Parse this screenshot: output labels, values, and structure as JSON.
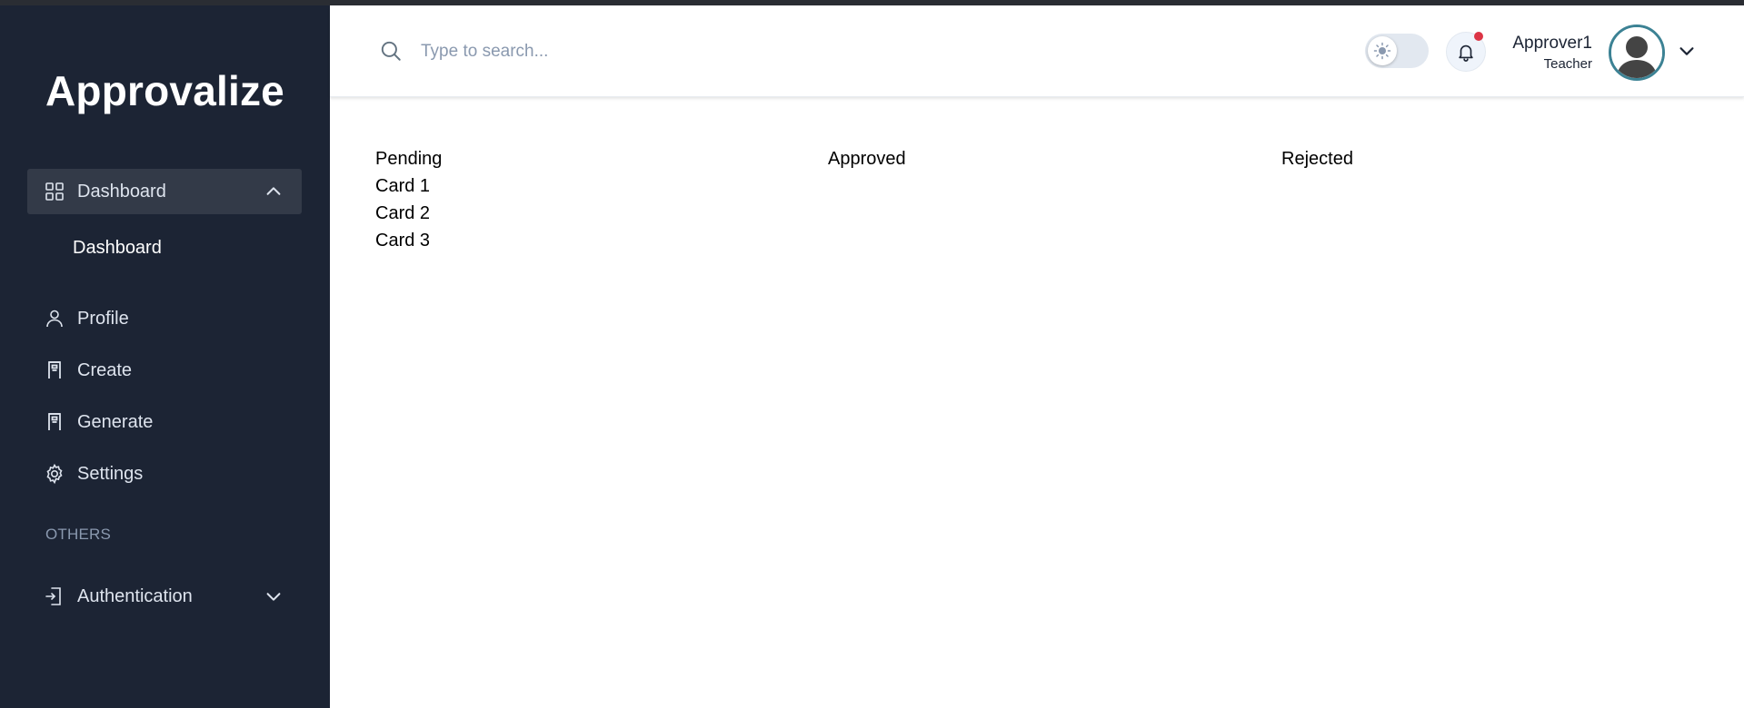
{
  "app": {
    "title": "Approvalize"
  },
  "sidebar": {
    "menu": [
      {
        "label": "Dashboard"
      },
      {
        "label": "Profile"
      },
      {
        "label": "Create"
      },
      {
        "label": "Generate"
      },
      {
        "label": "Settings"
      }
    ],
    "submenu_dashboard": "Dashboard",
    "section_others": "OTHERS",
    "authentication": "Authentication"
  },
  "header": {
    "search": {
      "placeholder": "Type to search..."
    },
    "user": {
      "name": "Approver1",
      "role": "Teacher"
    },
    "notification_dot_color": "#dc3545"
  },
  "board": {
    "columns": [
      {
        "title": "Pending",
        "cards": [
          "Card 1",
          "Card 2",
          "Card 3"
        ]
      },
      {
        "title": "Approved",
        "cards": []
      },
      {
        "title": "Rejected",
        "cards": []
      }
    ]
  },
  "colors": {
    "sidebar_bg": "#1c2434",
    "sidebar_active": "#333a48",
    "avatar_ring": "#3c8294"
  }
}
